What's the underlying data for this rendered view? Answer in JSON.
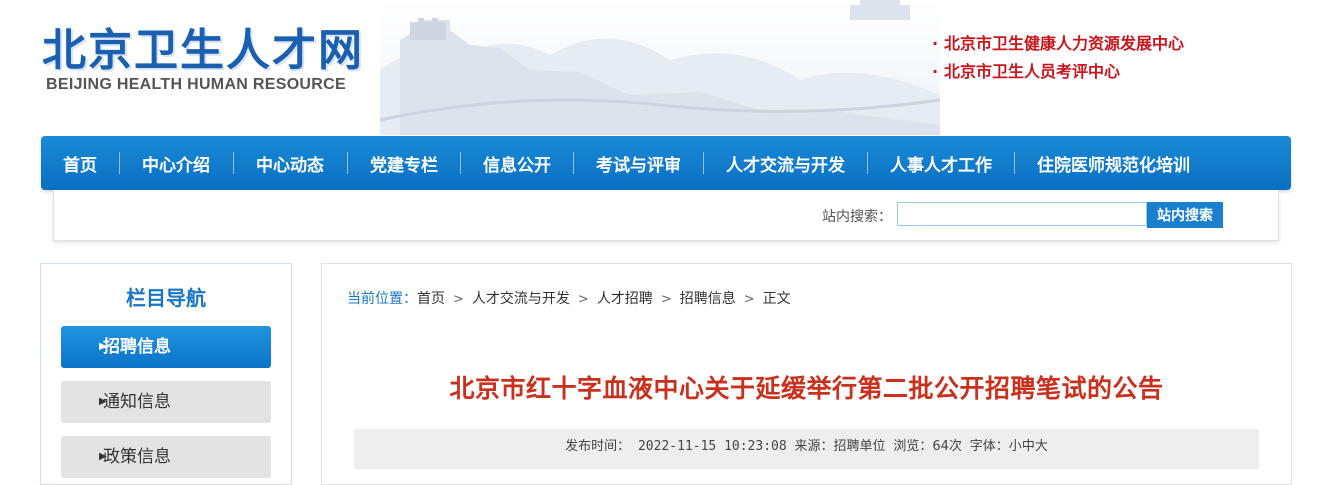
{
  "header": {
    "logo_cn": "北京卫生人才网",
    "logo_en": "BEIJING HEALTH HUMAN RESOURCE",
    "links": [
      {
        "label": "北京市卫生健康人力资源发展中心"
      },
      {
        "label": "北京市卫生人员考评中心"
      }
    ]
  },
  "nav": {
    "items": [
      {
        "label": "首页"
      },
      {
        "label": "中心介绍"
      },
      {
        "label": "中心动态"
      },
      {
        "label": "党建专栏"
      },
      {
        "label": "信息公开"
      },
      {
        "label": "考试与评审"
      },
      {
        "label": "人才交流与开发"
      },
      {
        "label": "人事人才工作"
      },
      {
        "label": "住院医师规范化培训"
      }
    ]
  },
  "search": {
    "label": "站内搜索：",
    "value": "",
    "button": "站内搜索"
  },
  "sidebar": {
    "title": "栏目导航",
    "items": [
      {
        "label": "招聘信息"
      },
      {
        "label": "通知信息"
      },
      {
        "label": "政策信息"
      }
    ]
  },
  "breadcrumb": {
    "label": "当前位置：",
    "items": [
      "首页",
      "人才交流与开发",
      "人才招聘",
      "招聘信息",
      "正文"
    ]
  },
  "article": {
    "title": "北京市红十字血液中心关于延缓举行第二批公开招聘笔试的公告",
    "meta": {
      "publish_label": "发布时间：",
      "publish_time": "2022-11-15 10:23:08",
      "source_label": "来源：",
      "source": "招聘单位",
      "views_label": "浏览：",
      "views": "64次",
      "font_label": "字体：",
      "font_sizes": [
        "小",
        "中",
        "大"
      ]
    }
  },
  "colors": {
    "brand_blue": "#1a7fce",
    "accent_red": "#c8161e",
    "title_red": "#c8311e"
  }
}
